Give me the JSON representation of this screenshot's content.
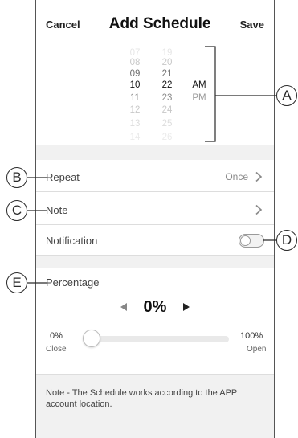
{
  "header": {
    "cancel_label": "Cancel",
    "title": "Add Schedule",
    "save_label": "Save"
  },
  "time_picker": {
    "hours": [
      "07",
      "08",
      "09",
      "10",
      "11",
      "12",
      "13",
      "14"
    ],
    "minutes": [
      "19",
      "20",
      "21",
      "22",
      "23",
      "24",
      "25",
      "26"
    ],
    "periods": [
      "AM",
      "PM"
    ],
    "selected": {
      "hour": "10",
      "minute": "22",
      "period": "AM"
    }
  },
  "repeat": {
    "label": "Repeat",
    "value": "Once"
  },
  "note": {
    "label": "Note"
  },
  "notification": {
    "label": "Notification",
    "enabled": false
  },
  "percentage": {
    "title": "Percentage",
    "value": "0%",
    "level": 0,
    "min_label": "0%",
    "min_sub": "Close",
    "max_label": "100%",
    "max_sub": "Open"
  },
  "footer_note": "Note - The Schedule works according to the APP account location.",
  "callouts": {
    "a": "A",
    "b": "B",
    "c": "C",
    "d": "D",
    "e": "E"
  },
  "colors": {
    "background": "#ffffff",
    "section_gap": "#f1f1f1",
    "text": "#333333",
    "muted": "#8a8a8a",
    "track": "#e9e9e9"
  }
}
